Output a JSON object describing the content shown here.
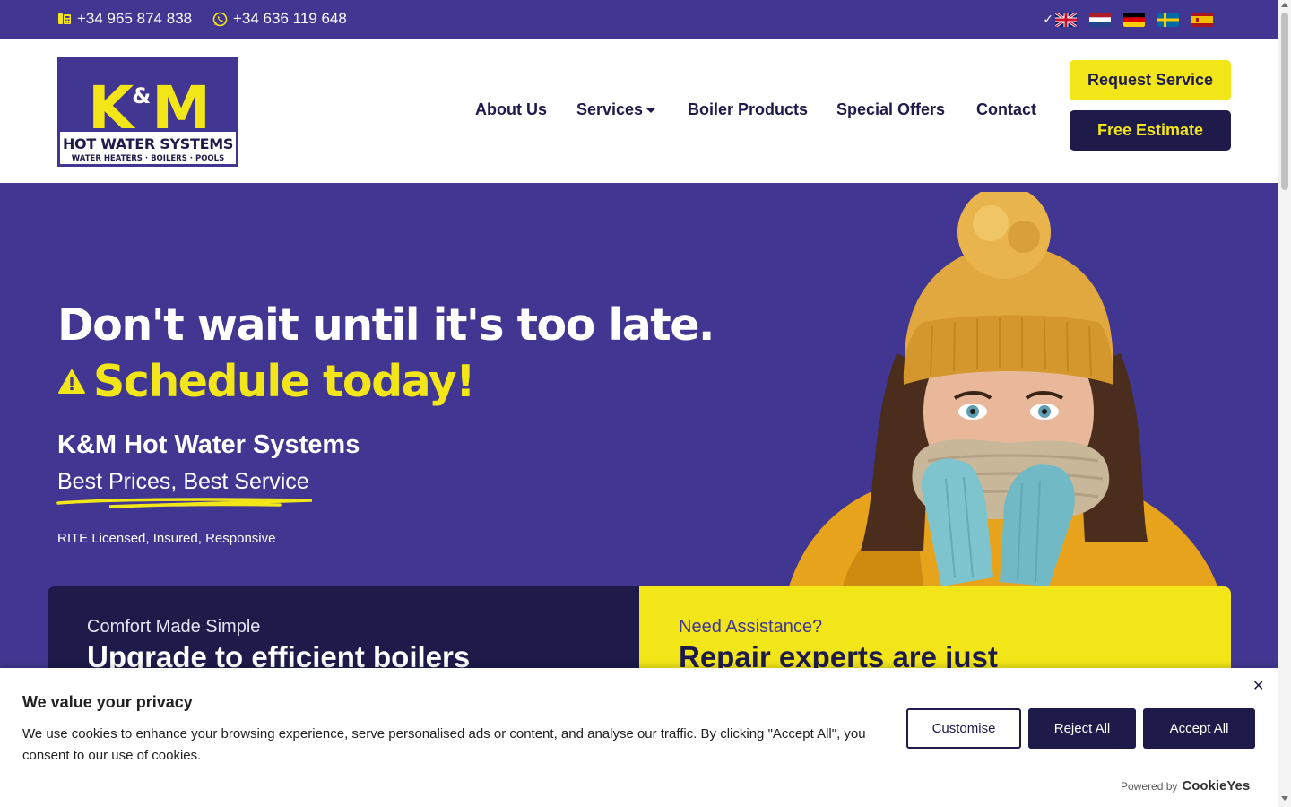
{
  "topbar": {
    "phone_icon": "phone-icon",
    "phone": "+34 965 874 838",
    "whatsapp_icon": "whatsapp-icon",
    "whatsapp": "+34 636 119 648",
    "languages": [
      "English",
      "Dutch",
      "German",
      "Swedish",
      "Spanish"
    ],
    "selected_language": "English"
  },
  "logo": {
    "k": "K",
    "amp": "&",
    "m": "M",
    "title": "HOT WATER SYSTEMS",
    "subtitle": "WATER HEATERS · BOILERS · POOLS"
  },
  "nav": {
    "about": "About Us",
    "services": "Services",
    "boiler_products": "Boiler Products",
    "special_offers": "Special Offers",
    "contact": "Contact"
  },
  "header_buttons": {
    "request_service": "Request Service",
    "free_estimate": "Free Estimate"
  },
  "hero": {
    "headline": "Don't wait until it's too late.",
    "cta_line": "Schedule today!",
    "company": "K&M Hot Water Systems",
    "tagline": "Best Prices, Best Service",
    "licensed": "RITE Licensed, Insured, Responsive"
  },
  "cards": {
    "left_kicker": "Comfort Made Simple",
    "left_title": "Upgrade to efficient boilers",
    "right_kicker": "Need Assistance?",
    "right_title": "Repair experts are just"
  },
  "cookie": {
    "title": "We value your privacy",
    "text": "We use cookies to enhance your browsing experience, serve personalised ads or content, and analyse our traffic. By clicking \"Accept All\", you consent to our use of cookies.",
    "close": "✕",
    "customise": "Customise",
    "reject": "Reject All",
    "accept": "Accept All",
    "powered_by": "Powered by",
    "brand": "CookieYes"
  },
  "colors": {
    "brand_purple": "#413691",
    "brand_navy": "#1e1b4b",
    "brand_yellow": "#f2e619"
  }
}
